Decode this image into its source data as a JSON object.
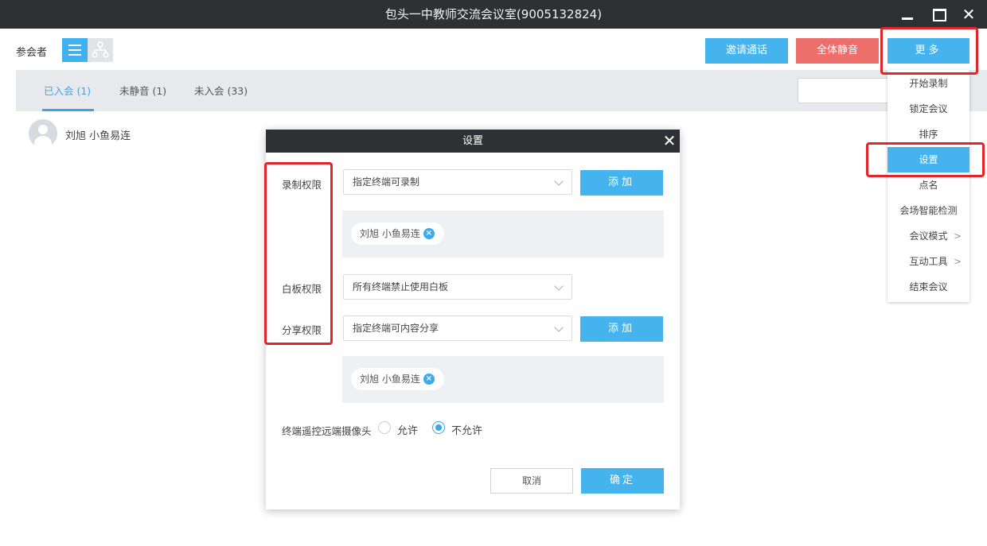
{
  "window": {
    "title": "包头一中教师交流会议室(9005132824)",
    "controls": {
      "minimize_icon": "minimize-icon",
      "maximize_icon": "maximize-icon",
      "close_glyph": "✕"
    }
  },
  "toolbar": {
    "participants_label": "参会者",
    "view_list_icon": "list-icon",
    "view_tree_icon": "org-tree-icon",
    "invite_label": "邀请通话",
    "mute_all_label": "全体静音",
    "more_label": "更多"
  },
  "tabs": [
    {
      "label": "已入会 (1)",
      "active": true
    },
    {
      "label": "未静音 (1)",
      "active": false
    },
    {
      "label": "未入会 (33)",
      "active": false
    }
  ],
  "participants": [
    {
      "name": "刘旭 小鱼易连"
    }
  ],
  "more_menu": {
    "items": [
      {
        "label": "开始录制",
        "active": false,
        "submenu": false
      },
      {
        "label": "锁定会议",
        "active": false,
        "submenu": false
      },
      {
        "label": "排序",
        "active": false,
        "submenu": false
      },
      {
        "label": "设置",
        "active": true,
        "submenu": false
      },
      {
        "label": "点名",
        "active": false,
        "submenu": false
      },
      {
        "label": "会场智能检测",
        "active": false,
        "submenu": false
      },
      {
        "label": "会议模式",
        "active": false,
        "submenu": true
      },
      {
        "label": "互动工具",
        "active": false,
        "submenu": true
      },
      {
        "label": "结束会议",
        "active": false,
        "submenu": false
      }
    ]
  },
  "settings_dialog": {
    "title": "设置",
    "close_glyph": "✕",
    "record": {
      "label": "录制权限",
      "value": "指定终端可录制",
      "add_label": "添加",
      "tags": [
        "刘旭 小鱼易连"
      ]
    },
    "whiteboard": {
      "label": "白板权限",
      "value": "所有终端禁止使用白板"
    },
    "share": {
      "label": "分享权限",
      "value": "指定终端可内容分享",
      "add_label": "添加",
      "tags": [
        "刘旭 小鱼易连"
      ]
    },
    "camera_control": {
      "label": "终端遥控远端摄像头",
      "options": [
        {
          "label": "允许",
          "checked": false
        },
        {
          "label": "不允许",
          "checked": true
        }
      ]
    },
    "cancel_label": "取消",
    "ok_label": "确定"
  },
  "colors": {
    "accent": "#45b4ee",
    "danger": "#ec6f6b",
    "titlebar": "#2f3033",
    "highlight": "#e0252b"
  }
}
